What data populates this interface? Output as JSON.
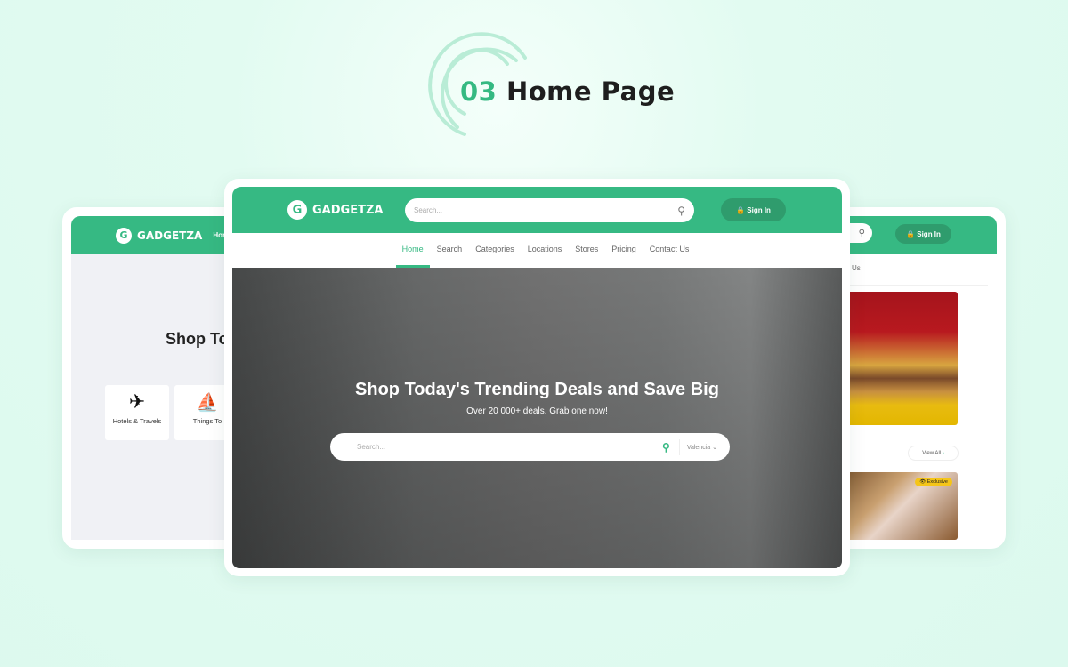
{
  "heading": {
    "number": "03",
    "text": "Home Page"
  },
  "brand": {
    "name": "GADGETZA",
    "logo_letter": "G"
  },
  "header": {
    "search_placeholder": "Search...",
    "sign_in": "Sign In"
  },
  "nav": {
    "items": [
      "Home",
      "Search",
      "Categories",
      "Locations",
      "Stores",
      "Pricing",
      "Contact Us"
    ],
    "active": "Home"
  },
  "hero": {
    "title": "Shop Today's Trending Deals and Save Big",
    "subtitle": "Over 20 000+ deals. Grab one now!",
    "search_placeholder": "Search...",
    "location": "Valencia"
  },
  "left_preview": {
    "nav_home": "Home",
    "title_partial": "Shop To",
    "categories": [
      {
        "label": "Hotels & Travels",
        "icon": "airplane-icon"
      },
      {
        "label": "Things To",
        "icon": "surfboard-icon"
      }
    ]
  },
  "right_preview": {
    "nav_partial": "Us",
    "sign_in": "Sign In",
    "view_all": "View All",
    "badge": "Exclusive"
  },
  "colors": {
    "brand": "#36b983",
    "brand_dark": "#2f9c6d",
    "background": "#e2fbf1",
    "badge": "#f5c518"
  }
}
